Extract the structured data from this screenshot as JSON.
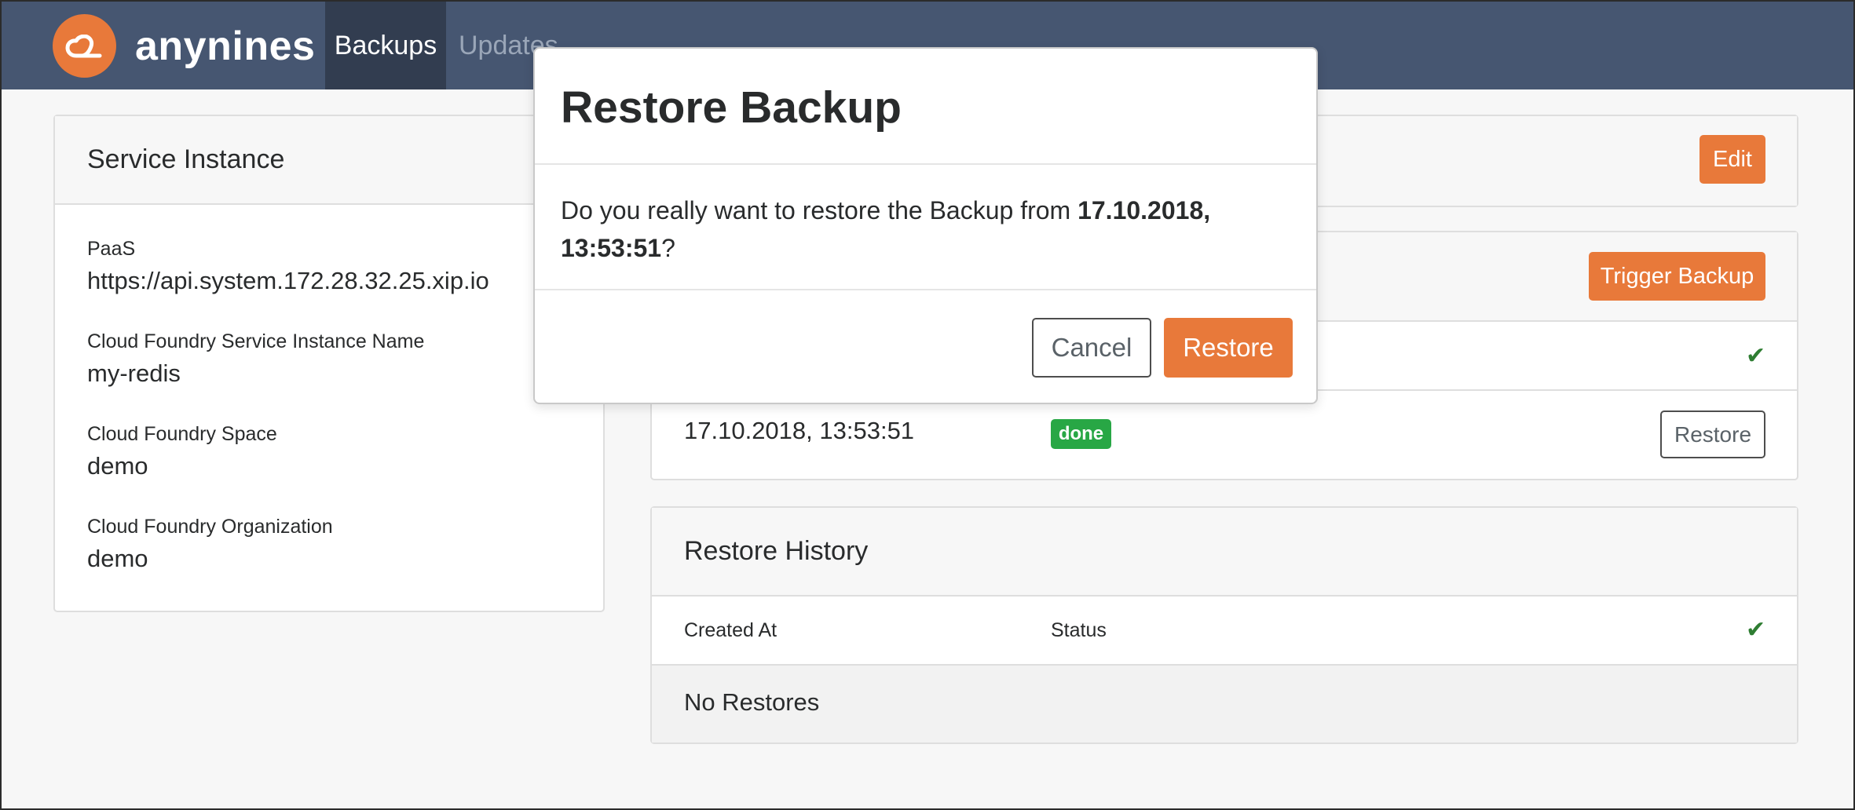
{
  "app": {
    "brand": "anynines",
    "nav": [
      {
        "label": "Backups",
        "active": true
      },
      {
        "label": "Updates",
        "active": false
      }
    ]
  },
  "service_instance": {
    "title": "Service Instance",
    "fields": [
      {
        "label": "PaaS",
        "value": "https://api.system.172.28.32.25.xip.io"
      },
      {
        "label": "Cloud Foundry Service Instance Name",
        "value": "my-redis"
      },
      {
        "label": "Cloud Foundry Space",
        "value": "demo"
      },
      {
        "label": "Cloud Foundry Organization",
        "value": "demo"
      }
    ]
  },
  "instance_card": {
    "edit_label": "Edit"
  },
  "backups": {
    "trigger_label": "Trigger Backup",
    "rows": [
      {
        "created_at": "17.10.2018, 13:53:51",
        "status": "done",
        "action_label": "Restore"
      }
    ]
  },
  "restore_history": {
    "title": "Restore History",
    "columns": {
      "created_at": "Created At",
      "status": "Status"
    },
    "empty_text": "No Restores"
  },
  "modal": {
    "title": "Restore Backup",
    "body_prefix": "Do you really want to restore the Backup from ",
    "body_timestamp": "17.10.2018, 13:53:51",
    "body_suffix": "?",
    "cancel_label": "Cancel",
    "confirm_label": "Restore"
  },
  "colors": {
    "navbar": "#465671",
    "nav_active": "#323d50",
    "accent": "#e8793a",
    "success": "#28a745",
    "check": "#2e7d32"
  },
  "icons": {
    "logo": "cloud-icon",
    "status_ok": "checkmark-icon"
  }
}
